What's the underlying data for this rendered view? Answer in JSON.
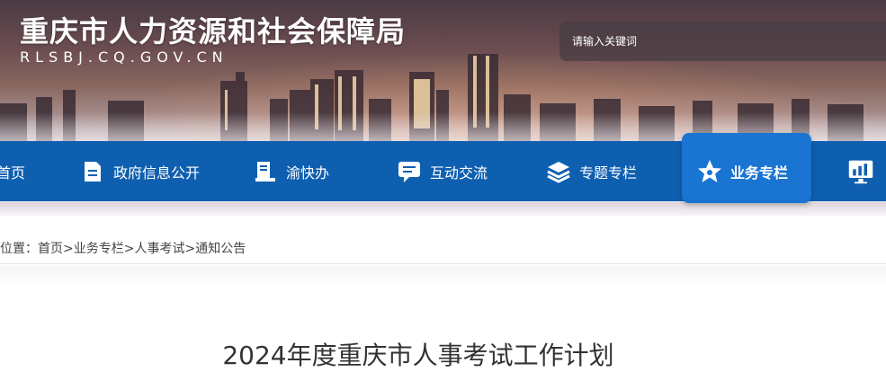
{
  "header": {
    "site_title": "重庆市人力资源和社会保障局",
    "site_domain": "RLSBJ.CQ.GOV.CN",
    "search_placeholder": "请输入关键词"
  },
  "nav": {
    "items": [
      {
        "label": "首页",
        "icon": "home-icon"
      },
      {
        "label": "政府信息公开",
        "icon": "document-icon"
      },
      {
        "label": "渝快办",
        "icon": "service-icon"
      },
      {
        "label": "互动交流",
        "icon": "chat-icon"
      },
      {
        "label": "专题专栏",
        "icon": "layers-icon"
      },
      {
        "label": "业务专栏",
        "icon": "star-icon",
        "active": true
      },
      {
        "label": "",
        "icon": "chart-icon"
      }
    ]
  },
  "breadcrumb": {
    "prefix": "位置：",
    "items": [
      "首页",
      "业务专栏",
      "人事考试",
      "通知公告"
    ],
    "separator": ">"
  },
  "article": {
    "title": "2024年度重庆市人事考试工作计划"
  },
  "colors": {
    "nav_bg": "#0f5fb0",
    "nav_active": "#1a75d2"
  }
}
